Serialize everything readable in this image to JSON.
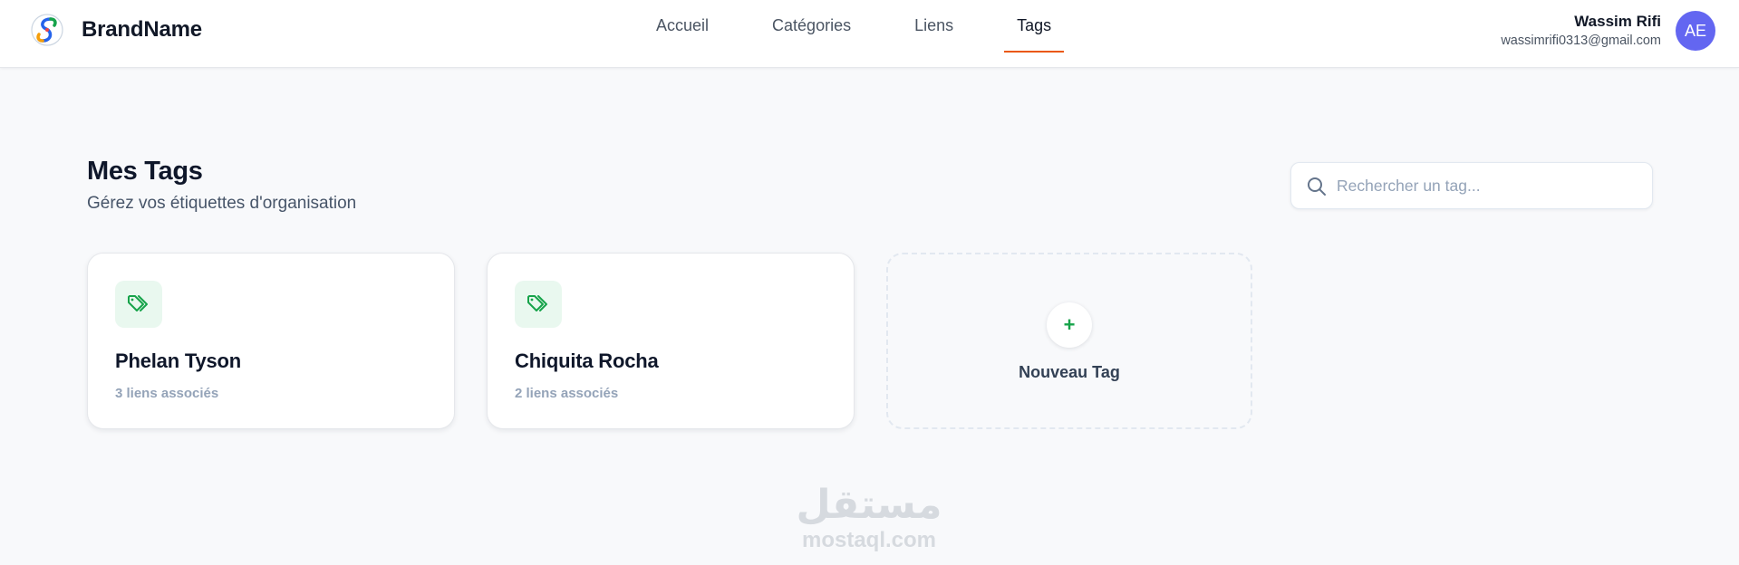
{
  "header": {
    "brand_name": "BrandName",
    "nav": [
      {
        "label": "Accueil",
        "active": false
      },
      {
        "label": "Catégories",
        "active": false
      },
      {
        "label": "Liens",
        "active": false
      },
      {
        "label": "Tags",
        "active": true
      }
    ],
    "user": {
      "name": "Wassim Rifi",
      "email": "wassimrifi0313@gmail.com",
      "initials": "AE"
    }
  },
  "page": {
    "title": "Mes Tags",
    "subtitle": "Gérez vos étiquettes d'organisation"
  },
  "search": {
    "placeholder": "Rechercher un tag...",
    "value": ""
  },
  "tags": [
    {
      "name": "Phelan Tyson",
      "count_label": "3 liens associés"
    },
    {
      "name": "Chiquita Rocha",
      "count_label": "2 liens associés"
    }
  ],
  "new_tag": {
    "plus": "+",
    "label": "Nouveau Tag"
  },
  "watermark": {
    "arabic": "مستقل",
    "latin": "mostaql.com"
  },
  "colors": {
    "accent": "#ea580c",
    "avatar": "#6366f1",
    "tag_green": "#16a34a",
    "tag_bg": "#e9f8ef",
    "background": "#f8f9fb"
  }
}
